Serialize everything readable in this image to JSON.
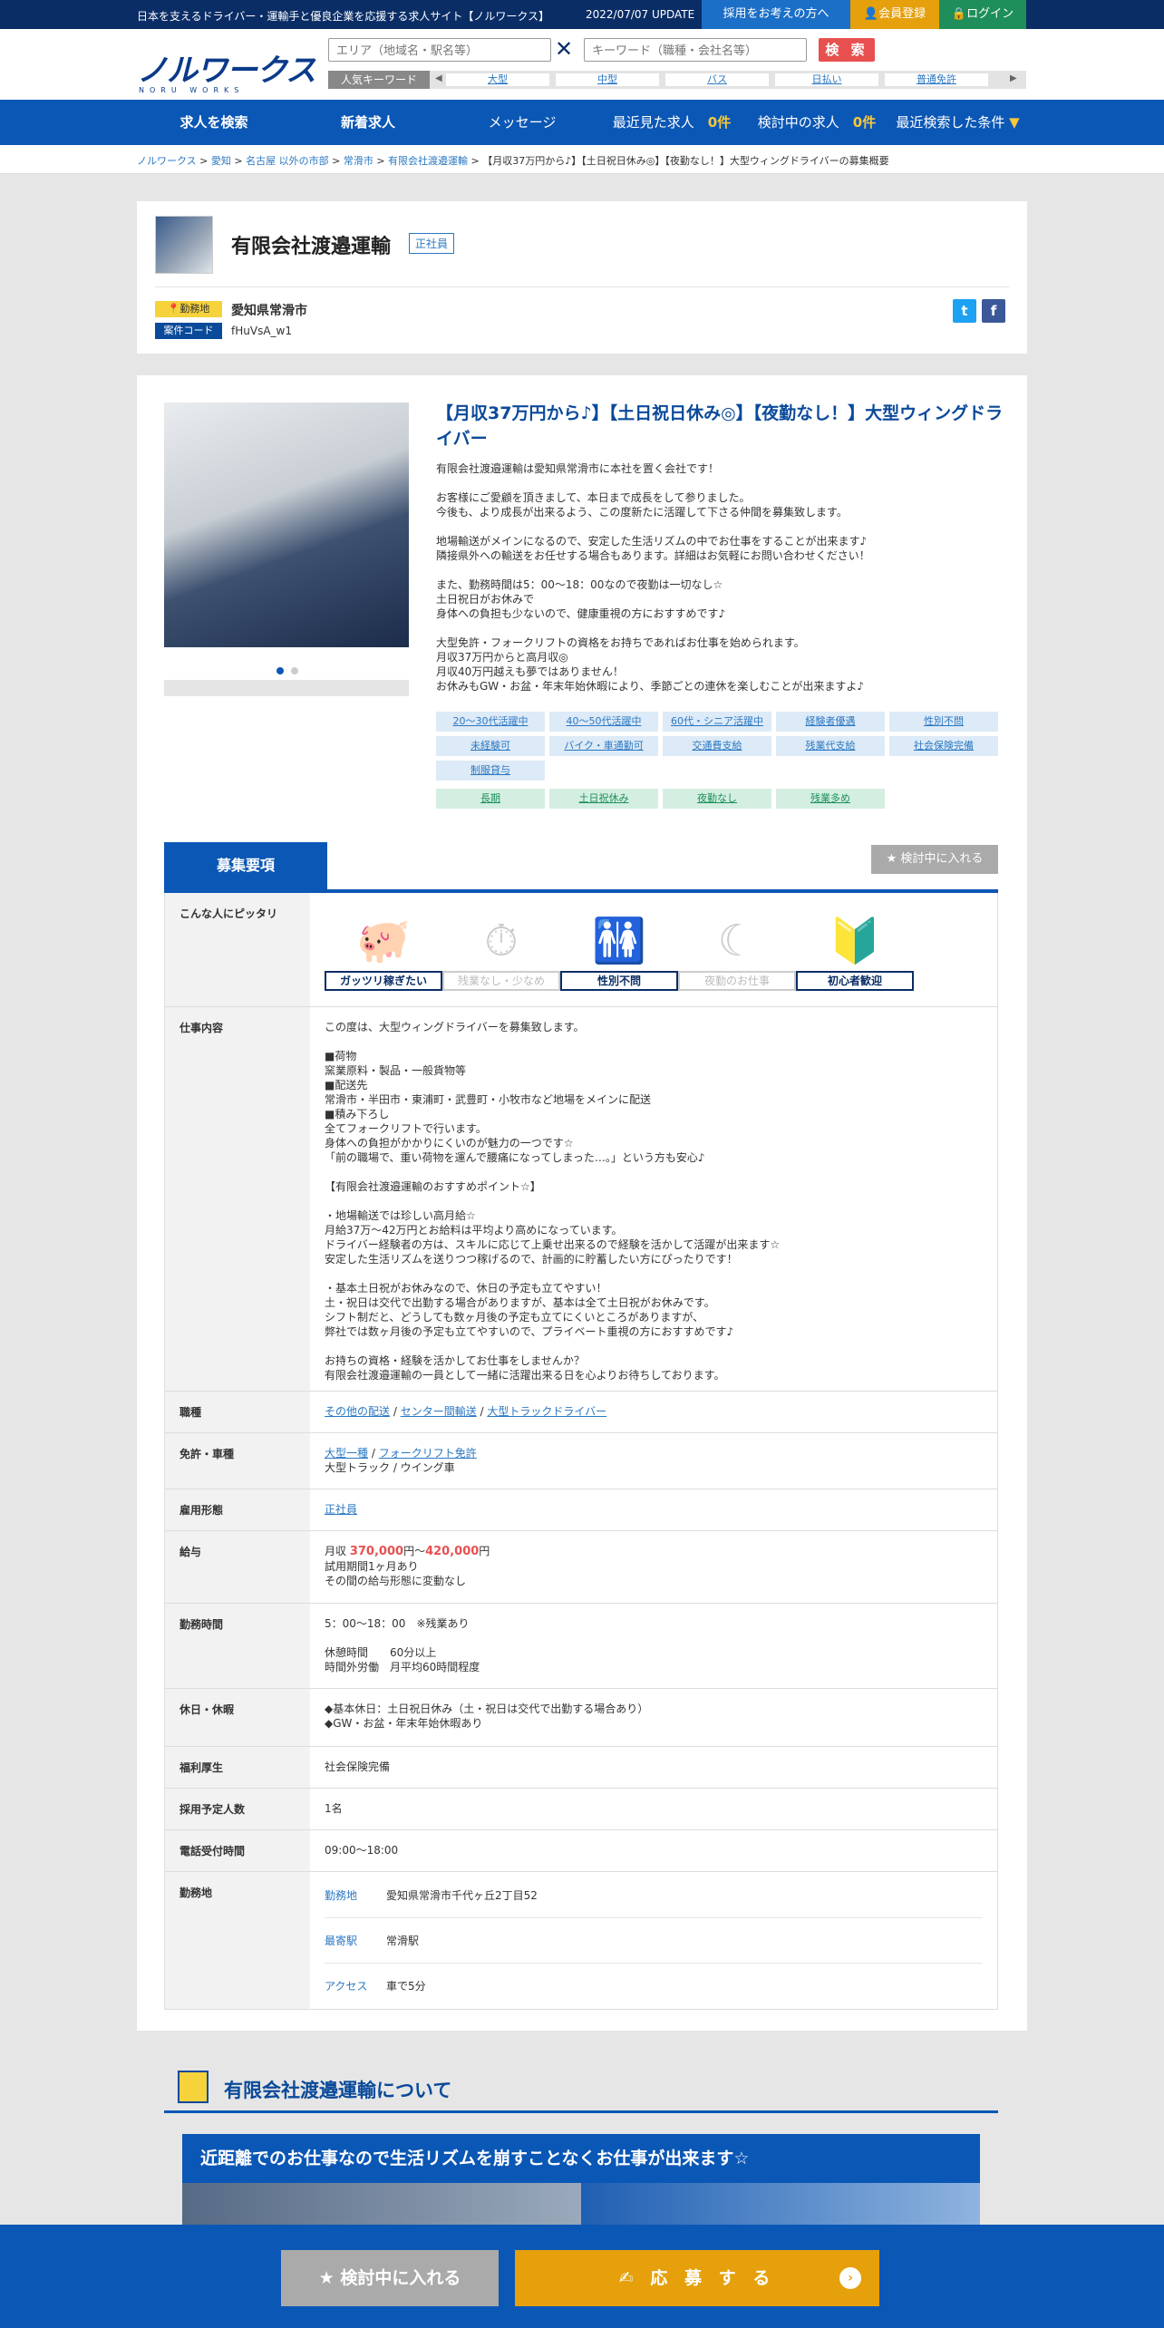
{
  "topbar": {
    "tagline": "日本を支えるドライバー・運輸手と優良企業を応援する求人サイト【ノルワークス】",
    "update": "2022/07/07 UPDATE",
    "employer_btn": "採用をお考えの方へ",
    "register_btn": "会員登録",
    "login_btn": "ログイン"
  },
  "header": {
    "logo": "ノルワークス",
    "logo_sub": "NORU WORKS",
    "area_placeholder": "エリア（地域名・駅名等）",
    "keyword_placeholder": "キーワード（職種・会社名等）",
    "search_btn": "検 索",
    "popular_label": "人気キーワード",
    "keywords": [
      "大型",
      "中型",
      "バス",
      "日払い",
      "普通免許"
    ]
  },
  "nav": {
    "items": [
      "求人を検索",
      "新着求人",
      "メッセージ",
      "最近見た求人",
      "検討中の求人",
      "最近検索した条件"
    ],
    "recent_count": "0件",
    "consider_count": "0件"
  },
  "breadcrumb": {
    "items": [
      "ノルワークス",
      "愛知",
      "名古屋 以外の市部",
      "常滑市",
      "有限会社渡邉運輸"
    ],
    "current": "【月収37万円から♪】【土日祝日休み◎】【夜勤なし！】大型ウィングドライバーの募集概要"
  },
  "company": {
    "name": "有限会社渡邉運輸",
    "type_badge": "正社員",
    "location_label": "勤務地",
    "location": "愛知県常滑市",
    "code_label": "案件コード",
    "code": "fHuVsA_w1"
  },
  "job": {
    "title": "【月収37万円から♪】【土日祝日休み◎】【夜勤なし！】大型ウィングドライバー",
    "description": "有限会社渡邉運輸は愛知県常滑市に本社を置く会社です！\n\nお客様にご愛顧を頂きまして、本日まで成長をして参りました。\n今後も、より成長が出来るよう、この度新たに活躍して下さる仲間を募集致します。\n\n地場輸送がメインになるので、安定した生活リズムの中でお仕事をすることが出来ます♪\n隣接県外への輸送をお任せする場合もあります。詳細はお気軽にお問い合わせください！\n\nまた、勤務時間は5：00～18：00なので夜勤は一切なし☆\n土日祝日がお休みで\n身体への負担も少ないので、健康重視の方におすすめです♪\n\n大型免許・フォークリフトの資格をお持ちであればお仕事を始められます。\n月収37万円からと高月収◎\n月収40万円越えも夢ではありません！\nお休みもGW・お盆・年末年始休暇により、季節ごとの連休を楽しむことが出来ますよ♪",
    "tags_blue": [
      "20～30代活躍中",
      "40～50代活躍中",
      "60代・シニア活躍中",
      "経験者優遇",
      "性別不問",
      "未経験可",
      "バイク・車通勤可",
      "交通費支給",
      "残業代支給",
      "社会保険完備",
      "制服貸与"
    ],
    "tags_green": [
      "長期",
      "土日祝休み",
      "夜勤なし",
      "残業多め"
    ]
  },
  "requirements": {
    "tab": "募集要項",
    "fav_btn": "検討中に入れる",
    "fit_label": "こんな人にピッタリ",
    "fit": [
      {
        "label": "ガッツリ稼ぎたい",
        "on": true
      },
      {
        "label": "残業なし・少なめ",
        "on": false
      },
      {
        "label": "性別不問",
        "on": true
      },
      {
        "label": "夜勤のお仕事",
        "on": false
      },
      {
        "label": "初心者歓迎",
        "on": true
      }
    ],
    "work_label": "仕事内容",
    "work": "この度は、大型ウィングドライバーを募集致します。\n\n■荷物\n窯業原料・製品・一般貨物等\n■配送先\n常滑市・半田市・東浦町・武豊町・小牧市など地場をメインに配送\n■積み下ろし\n全てフォークリフトで行います。\n身体への負担がかかりにくいのが魅力の一つです☆\n「前の職場で、重い荷物を運んで腰痛になってしまった…。」という方も安心♪\n\n【有限会社渡邉運輸のおすすめポイント☆】\n\n・地場輸送では珍しい高月給☆\n月給37万～42万円とお給料は平均より高めになっています。\nドライバー経験者の方は、スキルに応じて上乗せ出来るので経験を活かして活躍が出来ます☆\n安定した生活リズムを送りつつ稼げるので、計画的に貯蓄したい方にぴったりです！\n\n・基本土日祝がお休みなので、休日の予定も立てやすい！\n土・祝日は交代で出勤する場合がありますが、基本は全て土日祝がお休みです。\nシフト制だと、どうしても数ヶ月後の予定も立てにくいところがありますが、\n弊社では数ヶ月後の予定も立てやすいので、プライベート重視の方におすすめです♪\n\nお持ちの資格・経験を活かしてお仕事をしませんか？\n有限会社渡邉運輸の一員として一緒に活躍出来る日を心よりお待ちしております。",
    "jobtype_label": "職種",
    "jobtypes": [
      "その他の配送",
      "センター間輸送",
      "大型トラックドライバー"
    ],
    "license_label": "免許・車種",
    "licenses": [
      "大型一種",
      "フォークリフト免許"
    ],
    "vehicle": "大型トラック / ウイング車",
    "emp_label": "雇用形態",
    "emp": "正社員",
    "salary_label": "給与",
    "salary_prefix": "月収",
    "salary_min": "370,000",
    "salary_sep": "円～",
    "salary_max": "420,000",
    "salary_unit": "円",
    "salary_note": "試用期間1ヶ月あり\nその間の給与形態に変動なし",
    "hours_label": "勤務時間",
    "hours": "5：00～18：00　※残業あり\n\n休憩時間　　60分以上\n時間外労働　月平均60時間程度",
    "holiday_label": "休日・休暇",
    "holiday": "◆基本休日：土日祝日休み（土・祝日は交代で出勤する場合あり）\n◆GW・お盆・年末年始休暇あり",
    "welfare_label": "福利厚生",
    "welfare": "社会保険完備",
    "hire_label": "採用予定人数",
    "hire": "1名",
    "phone_label": "電話受付時間",
    "phone": "09:00～18:00",
    "place_label": "勤務地",
    "place_sub": "勤務地",
    "place": "愛知県常滑市千代ヶ丘2丁目52",
    "station_sub": "最寄駅",
    "station": "常滑駅",
    "access_sub": "アクセス",
    "access": "車で5分"
  },
  "about": {
    "title": "有限会社渡邉運輸について",
    "banner": "近距離でのお仕事なので生活リズムを崩すことなくお仕事が出来ます☆"
  },
  "footer": {
    "fav_btn": "検討中に入れる",
    "apply_btn": "応 募 す る"
  },
  "colors": {
    "navy": "#0a2d66",
    "blue": "#0b57b5",
    "orange": "#e5a00c",
    "green": "#1e8f5a",
    "red": "#e85050"
  }
}
